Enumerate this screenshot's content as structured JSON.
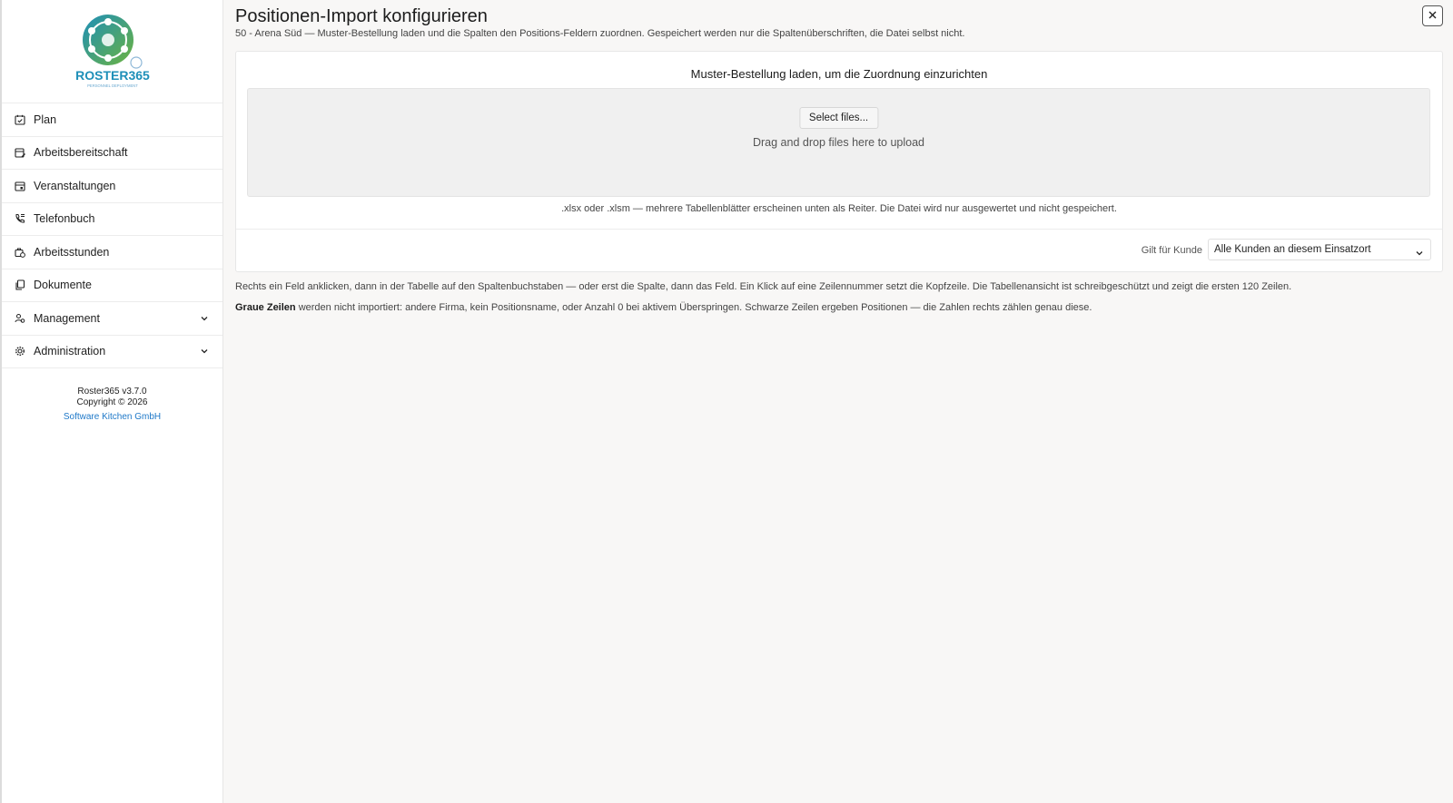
{
  "brand": {
    "name": "ROSTER365",
    "tagline": "PERSONNEL DEPLOYMENT",
    "colors": {
      "teal": "#1e8fb8",
      "green": "#6cb33f",
      "blue": "#1e78c8"
    }
  },
  "sidebar": {
    "items": [
      {
        "label": "Plan",
        "icon": "calendar-check-icon"
      },
      {
        "label": "Arbeitsbereitschaft",
        "icon": "calendar-edit-icon"
      },
      {
        "label": "Veranstaltungen",
        "icon": "calendar-event-icon"
      },
      {
        "label": "Telefonbuch",
        "icon": "phone-book-icon"
      },
      {
        "label": "Arbeitsstunden",
        "icon": "briefcase-clock-icon"
      },
      {
        "label": "Dokumente",
        "icon": "documents-icon"
      },
      {
        "label": "Management",
        "icon": "people-icon",
        "expandable": true
      },
      {
        "label": "Administration",
        "icon": "gear-icon",
        "expandable": true
      }
    ],
    "footer": {
      "version": "Roster365 v3.7.0",
      "copyright": "Copyright © 2026",
      "company": "Software Kitchen GmbH"
    }
  },
  "dialog": {
    "title": "Positionen-Import konfigurieren",
    "subtitle": "50 - Arena Süd — Muster-Bestellung laden und die Spalten den Positions-Feldern zuordnen. Gespeichert werden nur die Spaltenüberschriften, die Datei selbst nicht.",
    "card": {
      "heading": "Muster-Bestellung laden, um die Zuordnung einzurichten",
      "select_files": "Select files...",
      "drop_text": "Drag and drop files here to upload",
      "hint": ".xlsx oder .xlsm — mehrere Tabellenblätter erscheinen unten als Reiter. Die Datei wird nur ausgewertet und nicht gespeichert.",
      "kunde_label": "Gilt für Kunde",
      "kunde_value": "Alle Kunden an diesem Einsatzort"
    },
    "info1": "Rechts ein Feld anklicken, dann in der Tabelle auf den Spaltenbuchstaben — oder erst die Spalte, dann das Feld. Ein Klick auf eine Zeilennummer setzt die Kopfzeile. Die Tabellenansicht ist schreibgeschützt und zeigt die ersten 120 Zeilen.",
    "info2_bold": "Graue Zeilen",
    "info2_rest": " werden nicht importiert: andere Firma, kein Positionsname, oder Anzahl 0 bei aktivem Überspringen. Schwarze Zeilen ergeben Positionen — die Zahlen rechts zählen genau diese."
  }
}
